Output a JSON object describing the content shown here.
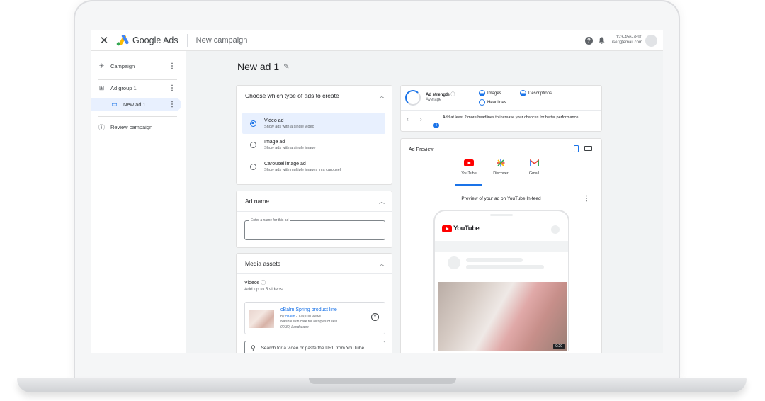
{
  "topbar": {
    "close_icon": "close-icon",
    "brand": "Google Ads",
    "campaign_title": "New campaign",
    "phone": "123-456-7890",
    "email": "user@email.com"
  },
  "sidebar": {
    "items": [
      {
        "label": "Campaign",
        "icon": "asterisk-icon"
      },
      {
        "label": "Ad group 1",
        "icon": "grid-icon"
      },
      {
        "label": "New ad 1",
        "icon": "window-icon"
      },
      {
        "label": "Review campaign",
        "icon": "info-icon"
      }
    ]
  },
  "main": {
    "title": "New ad 1"
  },
  "ad_type": {
    "heading": "Choose which type of ads to create",
    "options": [
      {
        "title": "Video ad",
        "subtitle": "Show ads with a single video",
        "selected": true
      },
      {
        "title": "Image ad",
        "subtitle": "Show ads with a single image",
        "selected": false
      },
      {
        "title": "Carousel image ad",
        "subtitle": "Show ads with multiple images in a carousel",
        "selected": false
      }
    ]
  },
  "ad_name": {
    "heading": "Ad name",
    "label": "Enter a name for this ad",
    "value": ""
  },
  "media": {
    "heading": "Media assets",
    "videos_label": "Videos",
    "videos_hint": "Add up to 5 videos",
    "video": {
      "title": "cBalm Spring product line",
      "by": "by ",
      "channel": "cBalm",
      "views": " - 129,000 views",
      "description": "Natural skin care for all types of skin",
      "meta": "00:30, Landscape"
    },
    "search_placeholder": "Search for a video or paste the URL from YouTube"
  },
  "strength": {
    "label": "Ad strength",
    "value": "Average",
    "checks": [
      "Images",
      "Descriptions",
      "Headlines"
    ],
    "tip": "Add at least 2 more headlines to increase your chances for better performance"
  },
  "preview": {
    "heading": "Ad Preview",
    "platforms": [
      "YouTube",
      "Discover",
      "Gmail"
    ],
    "caption": "Preview of your ad on YouTube In-feed",
    "yt_brand": "YouTube",
    "duration": "0:20"
  },
  "colors": {
    "accent": "#1a73e8",
    "youtube_red": "#ff0000",
    "selected_bg": "#e8f0fe"
  }
}
